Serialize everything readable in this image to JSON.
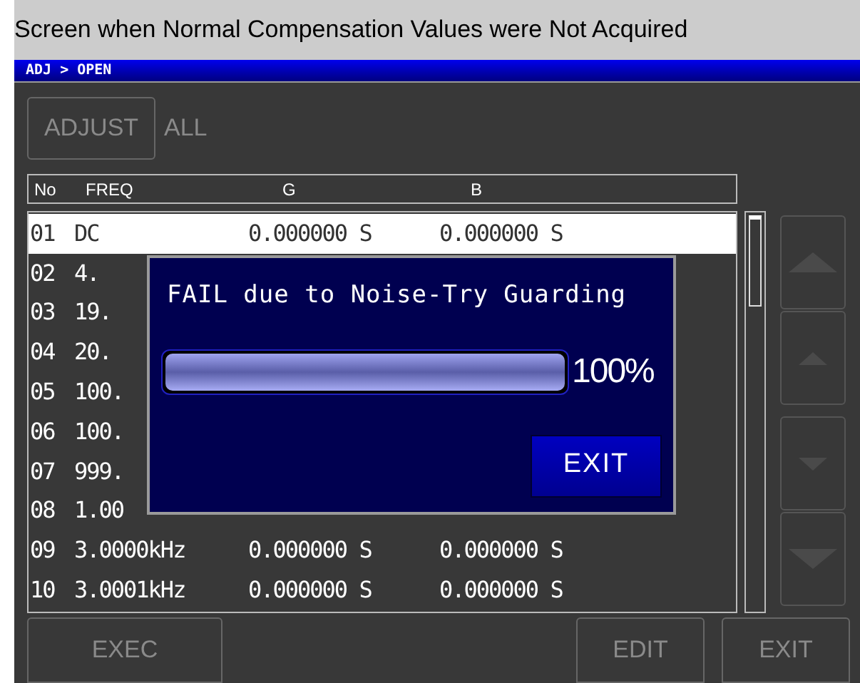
{
  "caption": "Screen when Normal Compensation Values were Not Acquired",
  "title_bar": "ADJ > OPEN",
  "mode_buttons": [
    {
      "label": "ADJUST",
      "disabled": true
    },
    {
      "label": "ALL",
      "disabled": true
    }
  ],
  "table": {
    "columns": [
      "No",
      "FREQ",
      "G",
      "B"
    ],
    "rows": [
      {
        "no": "01",
        "freq": "DC",
        "g": "0.000000 S",
        "b": "0.000000 S",
        "selected": true
      },
      {
        "no": "02",
        "freq": "4.",
        "selected": false
      },
      {
        "no": "03",
        "freq": "19.",
        "selected": false
      },
      {
        "no": "04",
        "freq": "20.",
        "selected": false
      },
      {
        "no": "05",
        "freq": "100.",
        "selected": false
      },
      {
        "no": "06",
        "freq": "100.",
        "selected": false
      },
      {
        "no": "07",
        "freq": "999.",
        "selected": false
      },
      {
        "no": "08",
        "freq": "1.00",
        "selected": false
      },
      {
        "no": "09",
        "freq": "3.0000kHz",
        "g": "0.000000 S",
        "b": "0.000000 S",
        "selected": false
      },
      {
        "no": "10",
        "freq": "3.0001kHz",
        "g": "0.000000 S",
        "b": "0.000000 S",
        "selected": false
      }
    ]
  },
  "dialog": {
    "message": "FAIL due to Noise-Try Guarding",
    "progress": {
      "level": 1.0,
      "reading": "100%"
    },
    "button": "EXIT"
  },
  "bottom_buttons": [
    {
      "label": "EXEC",
      "disabled": true
    },
    {
      "label": "EDIT",
      "disabled": true
    },
    {
      "label": "EXIT",
      "disabled": true
    }
  ]
}
